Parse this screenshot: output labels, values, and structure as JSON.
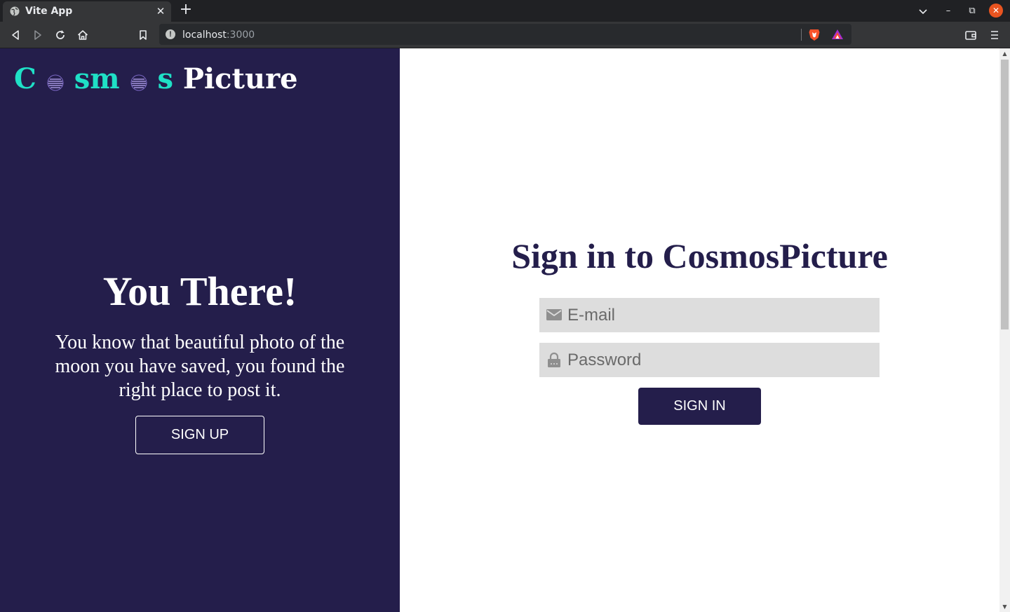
{
  "browser": {
    "tab_title": "Vite App",
    "tab_close": "✕",
    "new_tab": "+",
    "url_host": "localhost",
    "url_port": ":3000",
    "window_controls": {
      "minimize": "–",
      "restore": "⧉",
      "close": "✕"
    },
    "icons": [
      "globe-icon",
      "back-icon",
      "forward-icon",
      "reload-icon",
      "home-icon",
      "bookmark-icon",
      "info-icon",
      "brave-shield-icon",
      "brave-rewards-icon",
      "wallet-icon",
      "menu-icon"
    ]
  },
  "left_panel": {
    "logo": {
      "part1": "C",
      "part2": "sm",
      "part3": "s",
      "part4": "Picture"
    },
    "title": "You There!",
    "text": "You know that beautiful photo of the moon you have saved, you found the right place to post it.",
    "signup_label": "SIGN UP"
  },
  "signin": {
    "title": "Sign in to CosmosPicture",
    "email_placeholder": "E-mail",
    "password_placeholder": "Password",
    "submit_label": "SIGN IN"
  },
  "colors": {
    "panel": "#241e4b",
    "accent": "#1fe0c6",
    "field": "#dddddd",
    "browser_close": "#e95420"
  },
  "scrollbar": {
    "up": "▲",
    "down": "▼"
  }
}
